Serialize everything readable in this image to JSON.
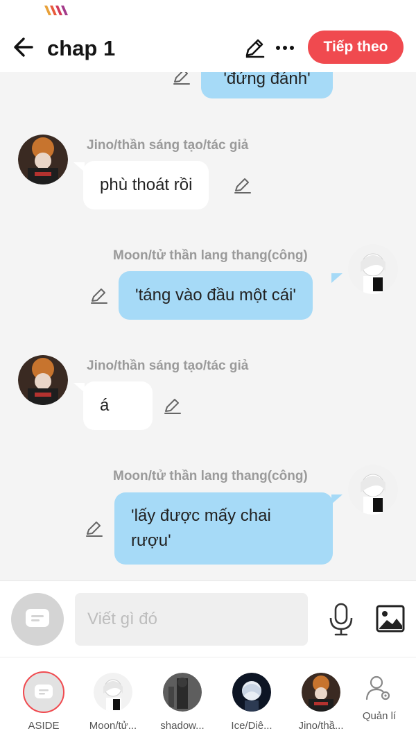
{
  "header": {
    "title": "chap 1",
    "next_label": "Tiếp theo"
  },
  "messages": [
    {
      "side": "right",
      "sender": "",
      "text": "'đứng đánh'",
      "partial": true
    },
    {
      "side": "left",
      "sender": "Jino/thần sáng tạo/tác giả",
      "text": "phù thoát rồi"
    },
    {
      "side": "right",
      "sender": "Moon/tử thần lang thang(công)",
      "text": "'táng vào đầu một cái'"
    },
    {
      "side": "left",
      "sender": "Jino/thần sáng tạo/tác giả",
      "text": "á"
    },
    {
      "side": "right",
      "sender": "Moon/tử thần lang thang(công)",
      "text_line1": "'lấy được mấy chai",
      "text_line2": "rượu'"
    }
  ],
  "composer": {
    "placeholder": "Viết gì đó"
  },
  "characters": [
    {
      "name": "ASIDE"
    },
    {
      "name": "Moon/tử..."
    },
    {
      "name": "shadow..."
    },
    {
      "name": "Ice/Diê..."
    },
    {
      "name": "Jino/thầ..."
    },
    {
      "name": "Quản lí"
    }
  ],
  "colors": {
    "accent": "#f04a4f",
    "right_bubble": "#a6daf7",
    "left_bubble": "#ffffff",
    "background": "#f4f4f4"
  },
  "icons": [
    "back-arrow-icon",
    "pencil-icon",
    "more-dots-icon",
    "chat-bubble-icon",
    "microphone-icon",
    "image-icon",
    "manage-user-icon"
  ]
}
